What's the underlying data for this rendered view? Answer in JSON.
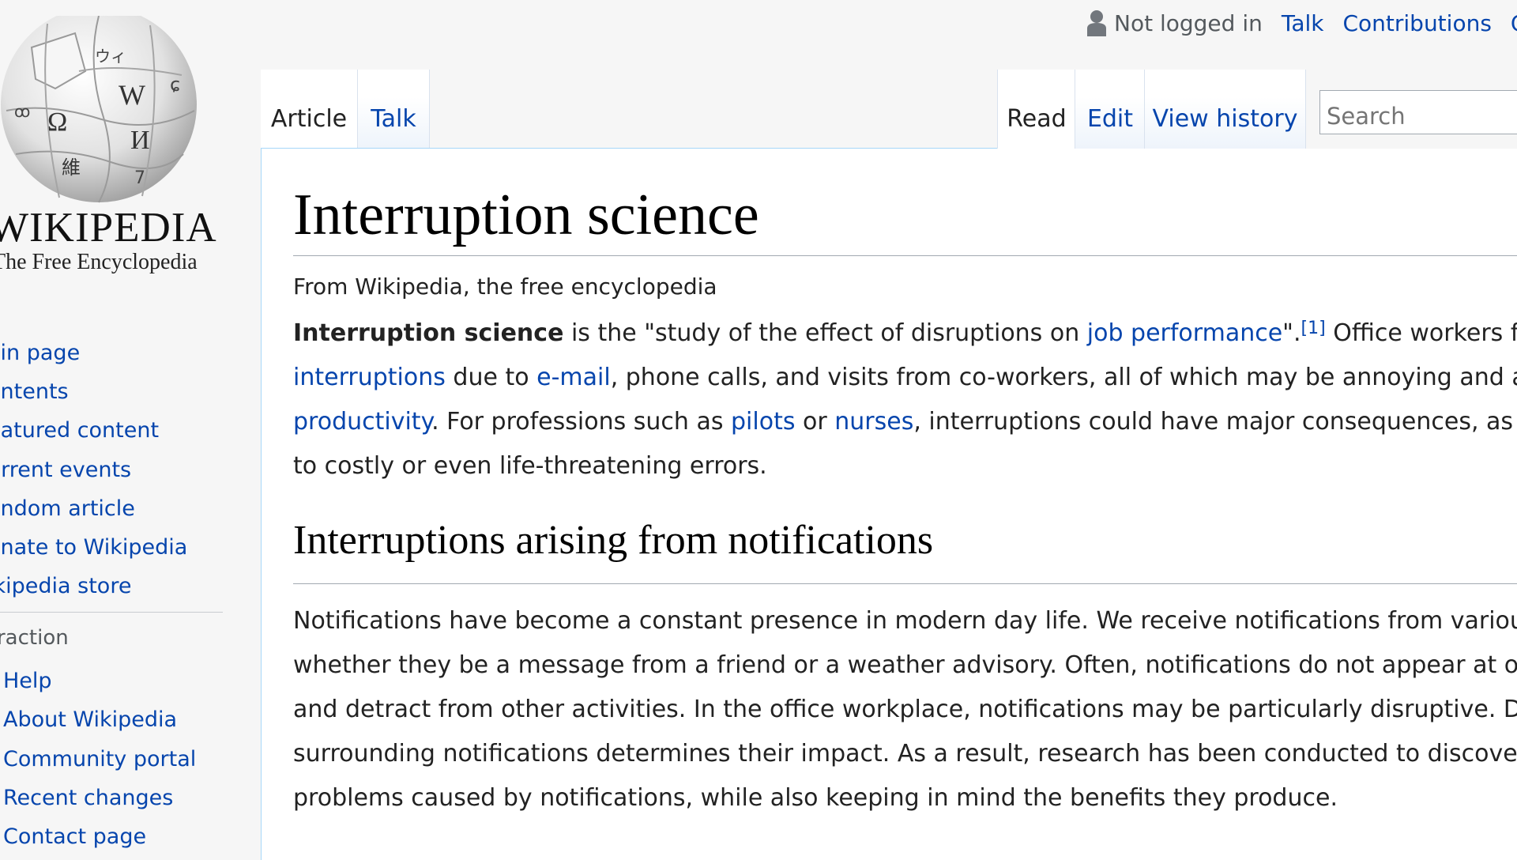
{
  "logo": {
    "wordmark": "WIKIPEDIA",
    "tagline": "The Free Encyclopedia"
  },
  "sidebar": {
    "navigation": [
      {
        "label": "ain page"
      },
      {
        "label": "ontents"
      },
      {
        "label": "eatured content"
      },
      {
        "label": "urrent events"
      },
      {
        "label": "andom article"
      },
      {
        "label": "onate to Wikipedia"
      },
      {
        "label": "ikipedia store"
      }
    ],
    "interaction_heading": "eraction",
    "interaction": [
      {
        "label": "Help"
      },
      {
        "label": "About Wikipedia"
      },
      {
        "label": "Community portal"
      },
      {
        "label": "Recent changes"
      },
      {
        "label": "Contact page"
      }
    ]
  },
  "personal": {
    "status": "Not logged in",
    "talk": "Talk",
    "contributions": "Contributions",
    "create": "Cre"
  },
  "tabs": {
    "article": "Article",
    "talk": "Talk",
    "read": "Read",
    "edit": "Edit",
    "view_history": "View history"
  },
  "search": {
    "placeholder": "Search"
  },
  "page": {
    "title": "Interruption science",
    "subtitle": "From Wikipedia, the free encyclopedia",
    "intro": {
      "bold_term": "Interruption science",
      "t1": " is the \"study of the effect of disruptions on ",
      "link_job_performance": "job performance",
      "t2": "\".",
      "ref": "[1]",
      "t3": " Office workers face",
      "link_interruptions": "interruptions",
      "t4": " due to ",
      "link_email": "e-mail",
      "t5": ", phone calls, and visits from co-workers, all of which may be annoying and a",
      "link_productivity": "productivity",
      "t6": ". For professions such as ",
      "link_pilots": "pilots",
      "t7": " or ",
      "link_nurses": "nurses",
      "t8": ", interruptions could have major consequences, as t",
      "t9": "to costly or even life-threatening errors."
    },
    "section_heading": "Interruptions arising from notifications",
    "notifications_lines": [
      "Notifications have become a constant presence in modern day life. We receive notifications from variou",
      "whether they be a message from a friend or a weather advisory. Often, notifications do not appear at op",
      "and detract from other activities. In the office workplace, notifications may be particularly disruptive. D",
      "surrounding notifications determines their impact. As a result, research has been conducted to discover",
      "problems caused by notifications, while also keeping in mind the benefits they produce."
    ]
  },
  "colors": {
    "link": "#0645ad",
    "tab_border": "#a7d7f9",
    "body_text": "#222222",
    "chrome_bg": "#f6f6f6"
  }
}
